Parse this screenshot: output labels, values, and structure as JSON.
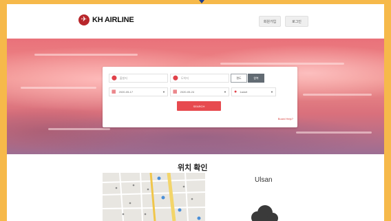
{
  "header": {
    "brand": "KH AIRLINE",
    "join_label": "회원가입",
    "login_label": "로그인"
  },
  "search": {
    "departure_placeholder": "출발지",
    "arrival_placeholder": "도착지",
    "trip_oneway": "편도",
    "trip_round": "왕복",
    "depart_date": "2020-05-17",
    "return_date": "2020-05-24",
    "passenger": "1adult",
    "search_label": "SEARCH",
    "board_link": "Board Help?"
  },
  "location": {
    "title": "위치 확인",
    "city": "Ulsan"
  },
  "colors": {
    "accent": "#e74a4f",
    "brand": "#b8262b",
    "frame": "#f6b94a"
  }
}
